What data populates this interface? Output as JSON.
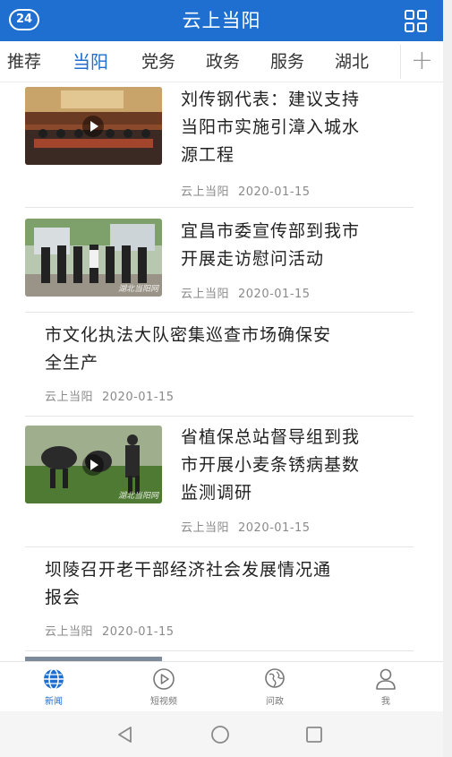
{
  "app": {
    "title": "云上当阳",
    "badge": "24",
    "accent": "#1e6fd0",
    "menu_icon": "grid-icon"
  },
  "tabs": [
    {
      "label": "推荐",
      "active": false
    },
    {
      "label": "当阳",
      "active": true
    },
    {
      "label": "党务",
      "active": false
    },
    {
      "label": "政务",
      "active": false
    },
    {
      "label": "服务",
      "active": false
    },
    {
      "label": "湖北",
      "active": false
    }
  ],
  "tab_add": "+",
  "articles": [
    {
      "title_lines": [
        "刘传钢代表：建议支持",
        "当阳市实施引漳入城水",
        "源工程"
      ],
      "source": "云上当阳",
      "date": "2020-01-15",
      "has_thumb": true,
      "video": true
    },
    {
      "title_lines": [
        "宜昌市委宣传部到我市",
        "开展走访慰问活动"
      ],
      "source": "云上当阳",
      "date": "2020-01-15",
      "has_thumb": true,
      "video": false,
      "watermark": "湖北当阳网"
    },
    {
      "title_lines": [
        "市文化执法大队密集巡查市场确保安",
        "全生产"
      ],
      "source": "云上当阳",
      "date": "2020-01-15",
      "has_thumb": false
    },
    {
      "title_lines": [
        "省植保总站督导组到我",
        "市开展小麦条锈病基数",
        "监测调研"
      ],
      "source": "云上当阳",
      "date": "2020-01-15",
      "has_thumb": true,
      "video": true,
      "watermark": "湖北当阳网"
    },
    {
      "title_lines": [
        "坝陵召开老干部经济社会发展情况通",
        "报会"
      ],
      "source": "云上当阳",
      "date": "2020-01-15",
      "has_thumb": false
    }
  ],
  "bottom_nav": [
    {
      "label": "新闻",
      "icon": "globe-icon",
      "active": true
    },
    {
      "label": "短视频",
      "icon": "play-circle-icon",
      "active": false
    },
    {
      "label": "问政",
      "icon": "chat-globe-icon",
      "active": false
    },
    {
      "label": "我",
      "icon": "person-icon",
      "active": false
    }
  ],
  "system_nav": [
    "back-icon",
    "home-icon",
    "recents-icon"
  ]
}
